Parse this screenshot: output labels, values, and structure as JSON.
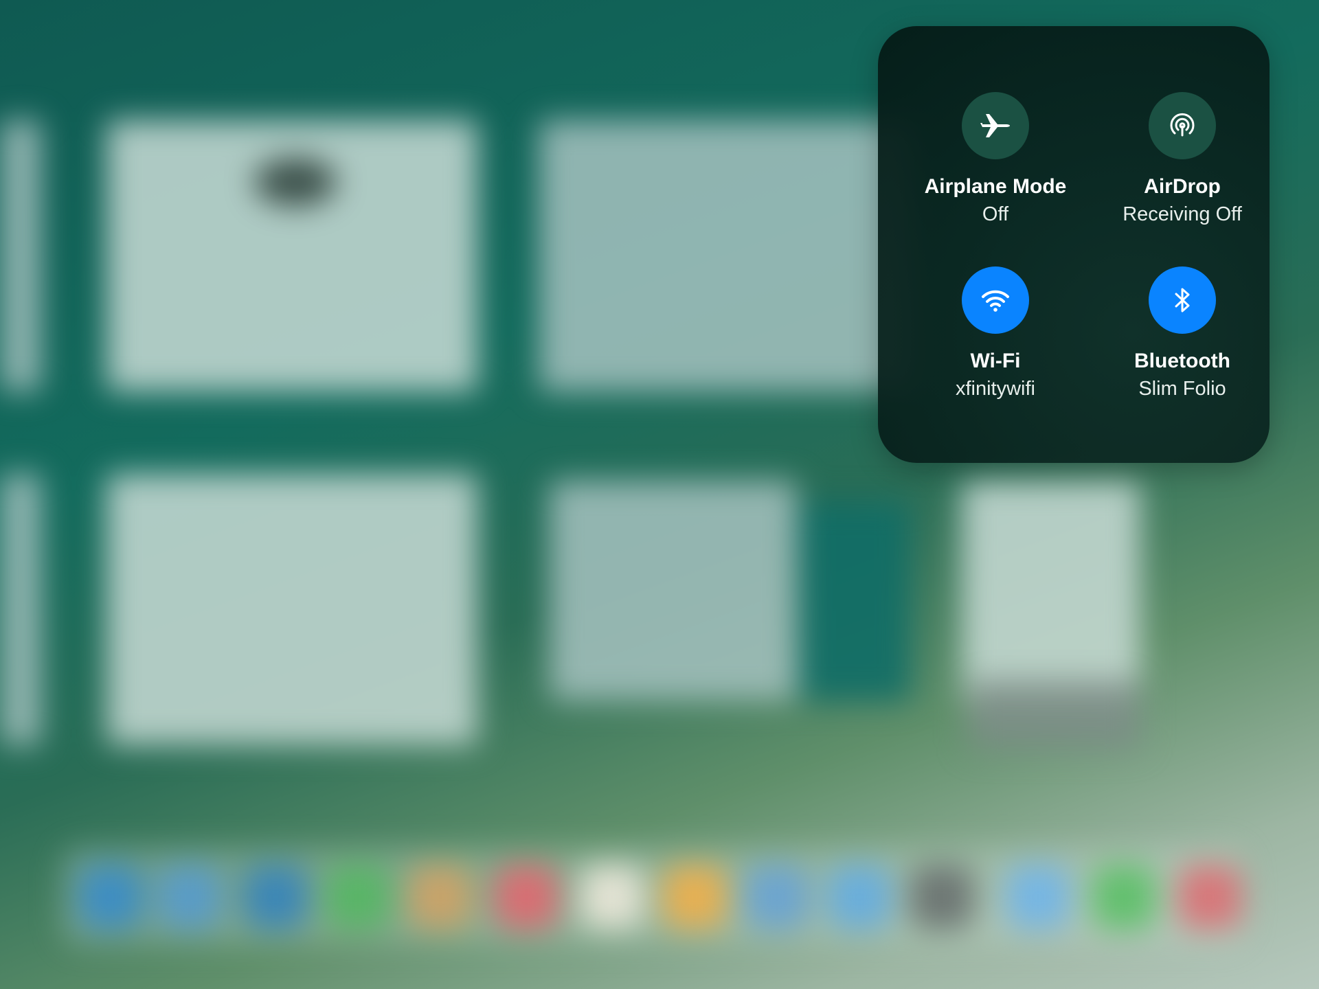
{
  "control_center": {
    "airplane": {
      "title": "Airplane Mode",
      "status": "Off",
      "on": false,
      "icon": "airplane-icon"
    },
    "airdrop": {
      "title": "AirDrop",
      "status": "Receiving Off",
      "on": false,
      "icon": "airdrop-icon"
    },
    "wifi": {
      "title": "Wi-Fi",
      "status": "xfinitywifi",
      "on": true,
      "icon": "wifi-icon"
    },
    "bluetooth": {
      "title": "Bluetooth",
      "status": "Slim Folio",
      "on": true,
      "icon": "bluetooth-icon"
    }
  },
  "colors": {
    "active_blue": "#0a84ff",
    "inactive_green": "#1b5143",
    "panel_dark": "#04231d"
  }
}
